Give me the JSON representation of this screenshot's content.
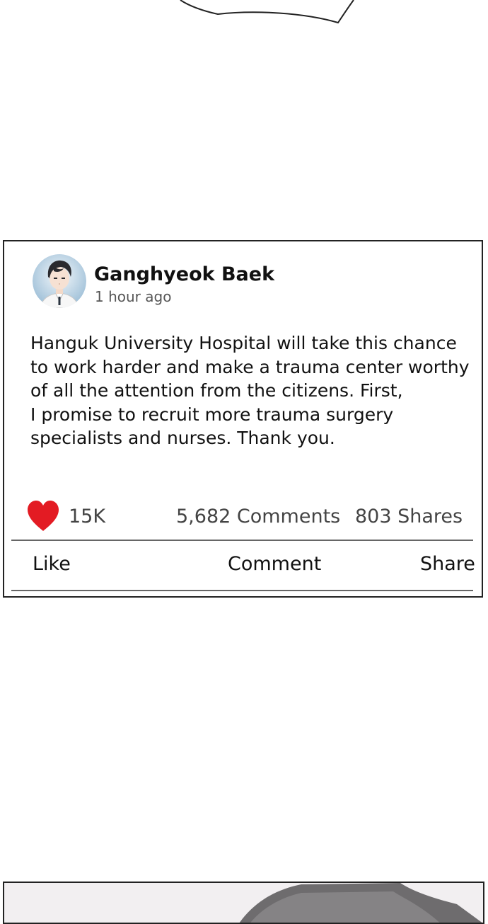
{
  "post": {
    "author": "Ganghyeok Baek",
    "time": "1 hour ago",
    "body_lines": [
      "Hanguk University Hospital will take this chance",
      "to work harder and make a trauma center worthy",
      "of all the attention from the citizens. First,",
      "I promise to recruit more trauma surgery",
      "specialists and nurses. Thank you."
    ],
    "stats": {
      "likes": "15K",
      "comments": "5,682 Comments",
      "shares": "803 Shares"
    },
    "actions": {
      "like": "Like",
      "comment": "Comment",
      "share": "Share"
    }
  },
  "colors": {
    "heart": "#e31b23",
    "border": "#222222",
    "stat_text": "#444444",
    "avatar_bg": "#c9dbe8"
  },
  "icons": {
    "reaction": "heart-icon",
    "avatar": "avatar"
  }
}
